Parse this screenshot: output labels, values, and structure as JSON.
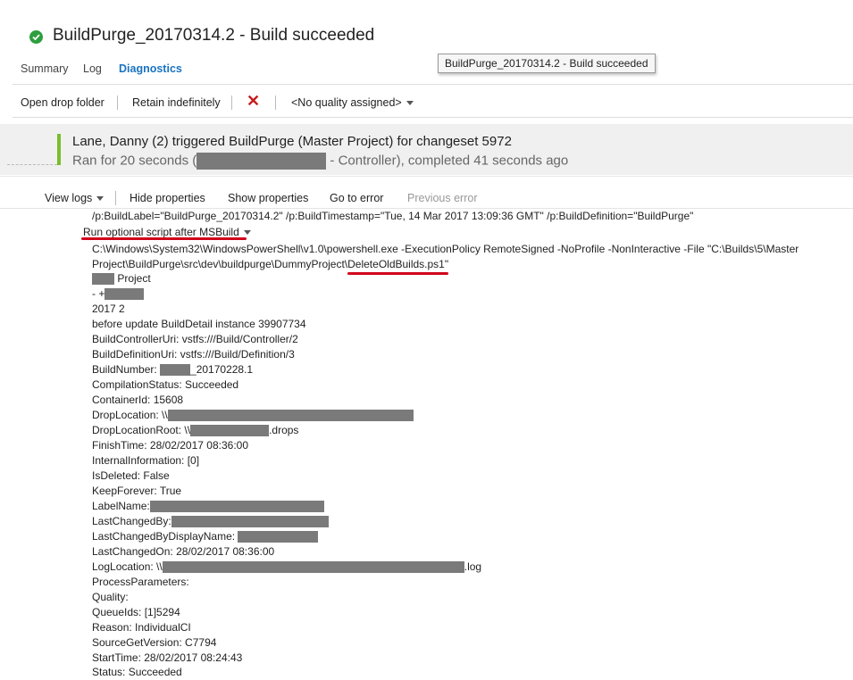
{
  "header": {
    "title": "BuildPurge_20170314.2 - Build succeeded",
    "status_icon": "check-circle-icon"
  },
  "tabs": [
    {
      "label": "Summary",
      "active": false
    },
    {
      "label": "Log",
      "active": false
    },
    {
      "label": "Diagnostics",
      "active": true
    }
  ],
  "tooltip": "BuildPurge_20170314.2 - Build succeeded",
  "toolbar": {
    "open_drop": "Open drop folder",
    "retain": "Retain indefinitely",
    "delete_icon": "delete-x-icon",
    "quality": "<No quality assigned>"
  },
  "banner": {
    "line1": "Lane, Danny (2) triggered BuildPurge (Master Project) for changeset 5972",
    "line2_prefix": "Ran for 20 seconds (",
    "line2_suffix": " - Controller), completed 41 seconds ago"
  },
  "logbar": {
    "view_logs": "View logs",
    "hide_props": "Hide properties",
    "show_props": "Show properties",
    "go_to_error": "Go to error",
    "previous_error": "Previous error"
  },
  "log": {
    "top_partial": "/p:BuildLabel=\"BuildPurge_20170314.2\" /p:BuildTimestamp=\"Tue, 14 Mar 2017 13:09:36 GMT\" /p:BuildDefinition=\"BuildPurge\"",
    "step_label": "Run optional script after MSBuild",
    "cmd_line1": "C:\\Windows\\System32\\WindowsPowerShell\\v1.0\\powershell.exe -ExecutionPolicy RemoteSigned -NoProfile -NonInteractive -File \"C:\\Builds\\5\\Master",
    "cmd_line2_prefix": "Project\\BuildPurge\\src\\dev\\buildpurge\\DummyProject\\",
    "cmd_line2_file": "DeleteOldBuilds.ps1",
    "cmd_line2_suffix": "\"",
    "project_suffix": " Project",
    "dash_plus": "- +",
    "year": "2017 2",
    "before_update": "before update BuildDetail instance 39907734",
    "controller_uri": "BuildControllerUri: vstfs:///Build/Controller/2",
    "definition_uri": "BuildDefinitionUri: vstfs:///Build/Definition/3",
    "build_number_prefix": "BuildNumber: ",
    "build_number_suffix": "_20170228.1",
    "compilation_status": "CompilationStatus: Succeeded",
    "container_id": "ContainerId: 15608",
    "drop_location": "DropLocation: \\\\",
    "drop_location_root_prefix": "DropLocationRoot: \\\\",
    "drop_location_root_suffix": ".drops",
    "finish_time": "FinishTime: 28/02/2017 08:36:00",
    "internal_info": "InternalInformation: [0]",
    "is_deleted": "IsDeleted: False",
    "keep_forever": "KeepForever: True",
    "label_name": "LabelName:",
    "last_changed_by": "LastChangedBy:",
    "last_changed_by_display": "LastChangedByDisplayName: ",
    "last_changed_on": "LastChangedOn: 28/02/2017 08:36:00",
    "log_location_prefix": "LogLocation: \\\\",
    "log_location_suffix": ".log",
    "process_parameters": "ProcessParameters:",
    "quality": "Quality:",
    "queue_ids": "QueueIds: [1]5294",
    "reason": "Reason: IndividualCI",
    "source_get_version": "SourceGetVersion: C7794",
    "start_time": "StartTime: 28/02/2017 08:24:43",
    "status": "Status: Succeeded"
  }
}
